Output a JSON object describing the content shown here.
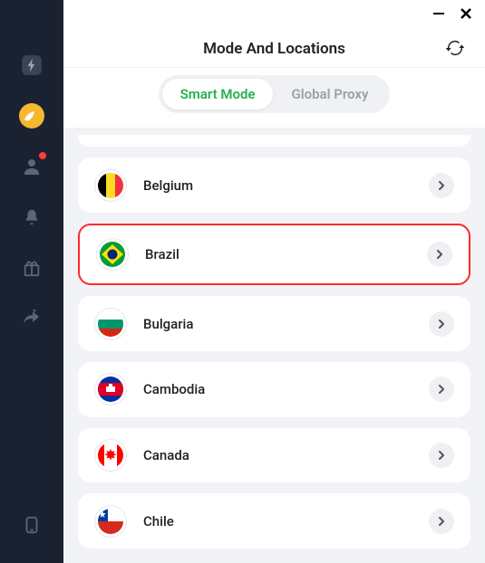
{
  "header": {
    "title": "Mode And Locations"
  },
  "tabs": {
    "smart": "Smart Mode",
    "global": "Global Proxy",
    "active": "smart"
  },
  "countries": [
    {
      "name": "Belgium",
      "flag": "belgium",
      "highlight": false
    },
    {
      "name": "Brazil",
      "flag": "brazil",
      "highlight": true
    },
    {
      "name": "Bulgaria",
      "flag": "bulgaria",
      "highlight": false
    },
    {
      "name": "Cambodia",
      "flag": "cambodia",
      "highlight": false
    },
    {
      "name": "Canada",
      "flag": "canada",
      "highlight": false
    },
    {
      "name": "Chile",
      "flag": "chile",
      "highlight": false
    }
  ]
}
